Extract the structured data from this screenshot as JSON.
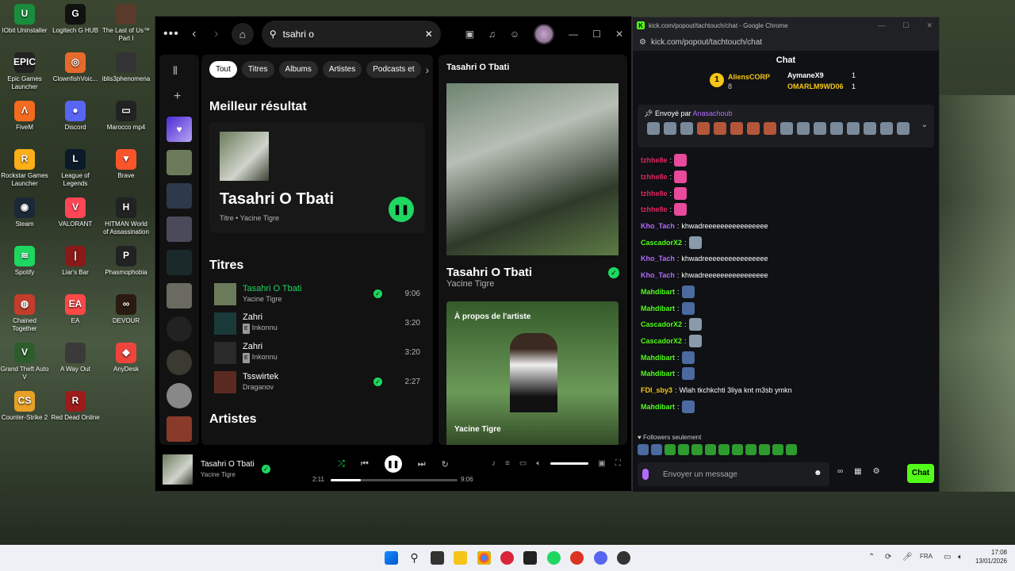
{
  "desktop": {
    "icons": [
      {
        "label": "IObit Uninstaller",
        "color": "#1a8d3c",
        "glyph": "U"
      },
      {
        "label": "Logitech G HUB",
        "color": "#111",
        "glyph": "G"
      },
      {
        "label": "The Last of Us™ Part I",
        "color": "#5a3a2a",
        "glyph": ""
      },
      {
        "label": "Epic Games Launcher",
        "color": "#222",
        "glyph": "EPIC"
      },
      {
        "label": "ClownfishVoic...",
        "color": "#e66a2c",
        "glyph": "◎"
      },
      {
        "label": "iblis3phenomena",
        "color": "#333",
        "glyph": ""
      },
      {
        "label": "FiveM",
        "color": "#f26b1f",
        "glyph": "Λ"
      },
      {
        "label": "Discord",
        "color": "#5865f2",
        "glyph": "●"
      },
      {
        "label": "Marocco mp4",
        "color": "#222",
        "glyph": "▭"
      },
      {
        "label": "Rockstar Games Launcher",
        "color": "#fcaf17",
        "glyph": "R"
      },
      {
        "label": "League of Legends",
        "color": "#0a1a2a",
        "glyph": "L"
      },
      {
        "label": "Brave",
        "color": "#fb542b",
        "glyph": "▼"
      },
      {
        "label": "Steam",
        "color": "#1b2838",
        "glyph": "◉"
      },
      {
        "label": "VALORANT",
        "color": "#ff4655",
        "glyph": "V"
      },
      {
        "label": "HITMAN World of Assassination",
        "color": "#222",
        "glyph": "H"
      },
      {
        "label": "Spotify",
        "color": "#1ed760",
        "glyph": "≋"
      },
      {
        "label": "Liar's Bar",
        "color": "#8a1a1a",
        "glyph": "|"
      },
      {
        "label": "Phasmophobia",
        "color": "#222",
        "glyph": "P"
      },
      {
        "label": "Chained Together",
        "color": "#c43c2a",
        "glyph": "◍"
      },
      {
        "label": "EA",
        "color": "#ff4747",
        "glyph": "EA"
      },
      {
        "label": "DEVOUR",
        "color": "#2a1a10",
        "glyph": "∞"
      },
      {
        "label": "Grand Theft Auto V",
        "color": "#2d5d2d",
        "glyph": "V"
      },
      {
        "label": "A Way Out",
        "color": "#3a3a3a",
        "glyph": ""
      },
      {
        "label": "AnyDesk",
        "color": "#ef443b",
        "glyph": "◆"
      },
      {
        "label": "Counter-Strike 2",
        "color": "#e8a126",
        "glyph": "CS"
      },
      {
        "label": "Red Dead Online",
        "color": "#9c1c1c",
        "glyph": "R"
      }
    ]
  },
  "spotify": {
    "search_value": "tsahri o",
    "chips": [
      "Tout",
      "Titres",
      "Albums",
      "Artistes",
      "Podcasts et"
    ],
    "best_heading": "Meilleur résultat",
    "best": {
      "title": "Tasahri O Tbati",
      "subtitle": "Titre • Yacine Tigre"
    },
    "titres_heading": "Titres",
    "tracks": [
      {
        "name": "Tasahri O Tbati",
        "artist": "Yacine Tigre",
        "duration": "9:06",
        "saved": true,
        "explicit": false,
        "playing": true
      },
      {
        "name": "Zahri",
        "artist": "Inkonnu",
        "duration": "3:20",
        "saved": false,
        "explicit": true,
        "playing": false
      },
      {
        "name": "Zahri",
        "artist": "Inkonnu",
        "duration": "3:20",
        "saved": false,
        "explicit": true,
        "playing": false
      },
      {
        "name": "Tsswirtek",
        "artist": "Draganov",
        "duration": "2:27",
        "saved": true,
        "explicit": false,
        "playing": false
      }
    ],
    "artistes_heading": "Artistes",
    "now_panel": {
      "title": "Tasahri O Tbati",
      "song": "Tasahri O Tbati",
      "artist": "Yacine Tigre",
      "about_label": "À propos de l'artiste",
      "about_name": "Yacine Tigre"
    },
    "player": {
      "title": "Tasahri O Tbati",
      "artist": "Yacine Tigre",
      "elapsed": "2:11",
      "total": "9:06",
      "progress": 0.24
    }
  },
  "chrome": {
    "title": "kick.com/popout/tachtouch/chat - Google Chrome",
    "url": "kick.com/popout/tachtouch/chat",
    "chat_heading": "Chat",
    "leaderboard": {
      "first": "AliensCORP",
      "first_count": "8",
      "second": "AymaneX9",
      "second_count": "1",
      "third": "OMARLM9WD06",
      "third_count": "1"
    },
    "pinned_prefix": "Envoyé par",
    "pinned_user": "Anasachoub",
    "messages": [
      {
        "user": "tzhhe8e",
        "text": "",
        "color": "#e0245e"
      },
      {
        "user": "tzhhe8e",
        "text": "",
        "color": "#e0245e"
      },
      {
        "user": "tzhhe8e",
        "text": "",
        "color": "#e0245e"
      },
      {
        "user": "tzhhe8e",
        "text": "",
        "color": "#e0245e"
      },
      {
        "user": "Kho_Tach",
        "text": "khwadreeeeeeeeeeeeeeee",
        "color": "#b46aff"
      },
      {
        "user": "CascadorX2",
        "text": "",
        "color": "#53fc18"
      },
      {
        "user": "Kho_Tach",
        "text": "khwadreeeeeeeeeeeeeeee",
        "color": "#b46aff"
      },
      {
        "user": "Kho_Tach",
        "text": "khwadreeeeeeeeeeeeeeee",
        "color": "#b46aff"
      },
      {
        "user": "Mahdibart",
        "text": "",
        "color": "#53fc18"
      },
      {
        "user": "Mahdibart",
        "text": "",
        "color": "#53fc18"
      },
      {
        "user": "CascadorX2",
        "text": "",
        "color": "#53fc18"
      },
      {
        "user": "CascadorX2",
        "text": "",
        "color": "#53fc18"
      },
      {
        "user": "Mahdibart",
        "text": "",
        "color": "#53fc18"
      },
      {
        "user": "Mahdibart",
        "text": "",
        "color": "#53fc18"
      },
      {
        "user": "FDI_sby3",
        "text": "Wlah tkchkchti 3liya knt m3sb ymkn",
        "color": "#f5c518"
      },
      {
        "user": "Mahdibart",
        "text": "",
        "color": "#53fc18"
      }
    ],
    "followers_only": "Followers seulement",
    "input_placeholder": "Envoyer un message",
    "send_label": "Chat"
  },
  "taskbar": {
    "lang": "FRA",
    "time": "17:08",
    "date": "13/01/2026"
  }
}
